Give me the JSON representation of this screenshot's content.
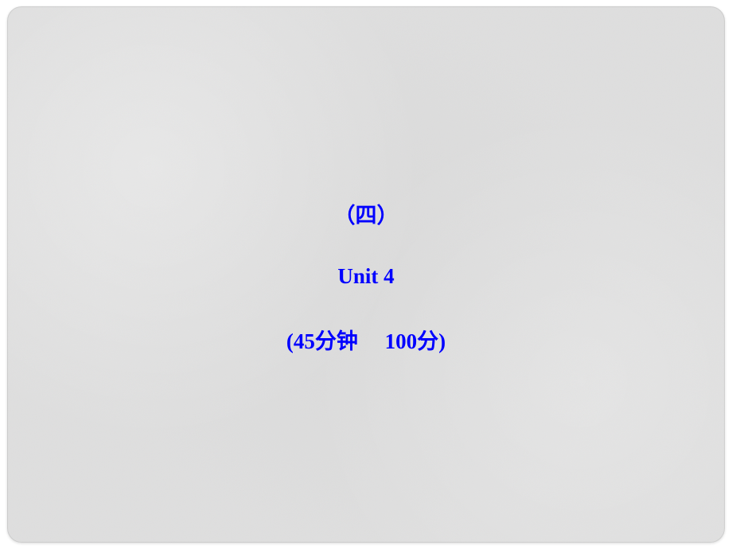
{
  "slide": {
    "line1": "（四）",
    "line2": "Unit 4",
    "line3": "(45分钟     100分)"
  }
}
